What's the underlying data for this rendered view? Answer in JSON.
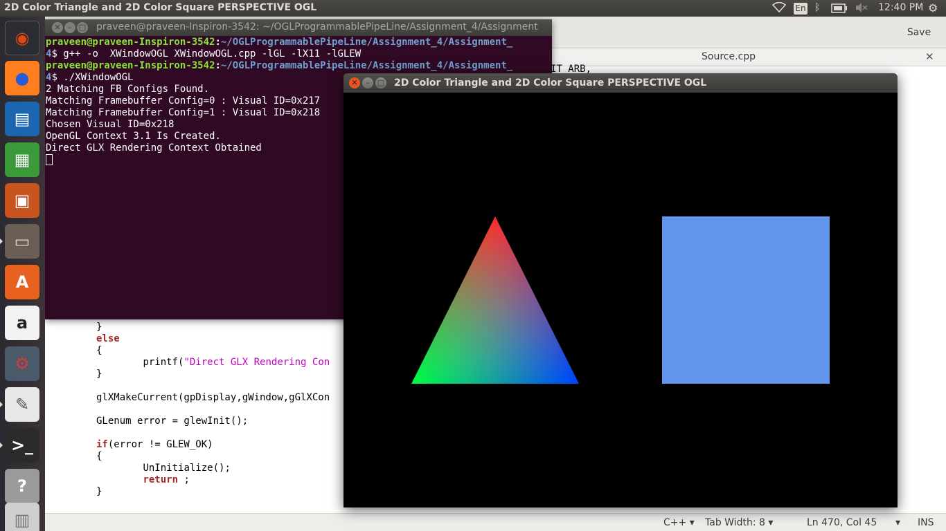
{
  "top_panel": {
    "title": "2D Color Triangle and 2D Color Square PERSPECTIVE OGL",
    "lang": "En",
    "clock": "12:40 PM"
  },
  "launcher": {
    "items": [
      {
        "name": "ubuntu-dash-icon",
        "color": "#2c2c33",
        "accent": "#dd4814"
      },
      {
        "name": "firefox-icon",
        "color": "#ff7e1f",
        "accent": "#2a5bd7"
      },
      {
        "name": "libreoffice-writer-icon",
        "color": "#1c65b0",
        "accent": "#ffffff"
      },
      {
        "name": "libreoffice-calc-icon",
        "color": "#3a9a3a",
        "accent": "#ffffff"
      },
      {
        "name": "libreoffice-impress-icon",
        "color": "#c9541e",
        "accent": "#ffffff"
      },
      {
        "name": "files-icon",
        "color": "#6b5f55",
        "accent": "#e0d7c8"
      },
      {
        "name": "software-center-icon",
        "color": "#e8611f",
        "accent": "#ffffff"
      },
      {
        "name": "amazon-icon",
        "color": "#f2f2f2",
        "accent": "#222222"
      },
      {
        "name": "system-settings-icon",
        "color": "#4a5a6a",
        "accent": "#d83b3b"
      },
      {
        "name": "text-editor-icon",
        "color": "#e8e8e8",
        "accent": "#555555"
      },
      {
        "name": "terminal-icon",
        "color": "#2b2b2b",
        "accent": "#ffffff"
      },
      {
        "name": "help-icon",
        "color": "#9a9a9a",
        "accent": "#ffffff"
      },
      {
        "name": "workspaces-icon",
        "color": "#cfcfcf",
        "accent": "#777777"
      }
    ]
  },
  "editor": {
    "save_label": "Save",
    "tab_label": "Source.cpp",
    "top_fragment": "IT_ARB,",
    "status": {
      "language": "C++",
      "tab_width": "Tab Width: 8",
      "position": "Ln 470, Col 45",
      "mode": "INS"
    }
  },
  "terminal": {
    "title": "praveen@praveen-Inspiron-3542: ~/OGLProgrammablePipeLine/Assignment_4/Assignment",
    "prompt_user": "praveen@praveen-Inspiron-3542",
    "prompt_path": "~/OGLProgrammablePipeLine/Assignment_4/Assignment_",
    "prompt_cont": "4",
    "cmd1": "$ g++ -o  XWindowOGL XWindowOGL.cpp -lGL -lX11 -lGLEW",
    "cmd2": "$ ./XWindowOGL",
    "output": [
      "2 Matching FB Configs Found.",
      "Matching Framebuffer Config=0 : Visual ID=0x217",
      "Matching Framebuffer Config=1 : Visual ID=0x218",
      "Chosen Visual ID=0x218",
      "OpenGL Context 3.1 Is Created.",
      "Direct GLX Rendering Context Obtained"
    ]
  },
  "ogl_window": {
    "title": "2D Color Triangle and 2D Color Square PERSPECTIVE OGL",
    "triangle_colors": {
      "top": "#ff0000",
      "left": "#00ff00",
      "right": "#0000ff"
    },
    "square_color": "#6495ed"
  },
  "code": {
    "else_kw": "else",
    "printf_fn": "printf(",
    "printf_str": "\"Direct GLX Rendering Con",
    "glx_call": "glXMakeCurrent(gpDisplay,gWindow,gGlXCon",
    "glenum_line": "GLenum error = glewInit();",
    "if_kw": "if",
    "if_cond": "(error != GLEW_OK)",
    "uninit": "UnInitialize();",
    "return_kw": "return",
    "return_rest": " ;"
  }
}
